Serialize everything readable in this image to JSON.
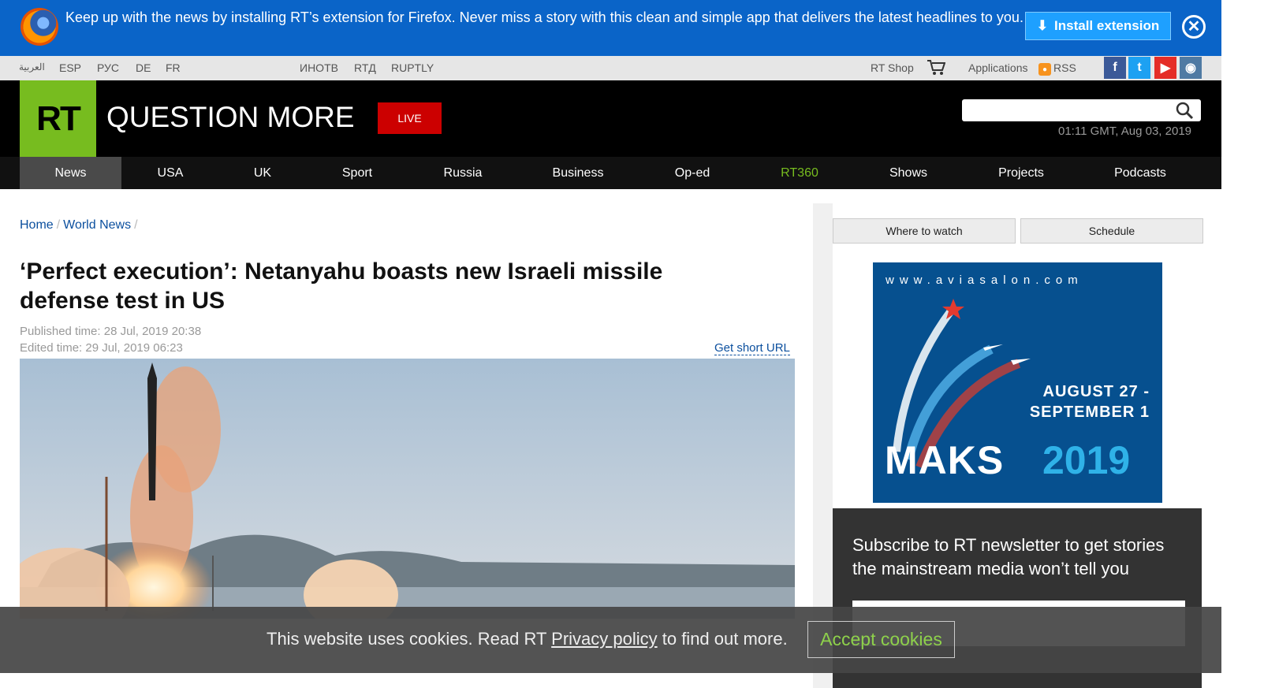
{
  "banner": {
    "text": "Keep up with the news by installing RT’s extension for Firefox. Never miss a story with this clean and simple app that delivers the latest headlines to you.",
    "install_label": "Install extension",
    "icons": [
      "firefox-icon",
      "download-arrow-icon",
      "close-icon"
    ]
  },
  "utility": {
    "languages": [
      "العربية",
      "ESP",
      "РУС",
      "DE",
      "FR"
    ],
    "networks": [
      "ИНОТВ",
      "RTД",
      "RUPTLY"
    ],
    "shop": "RT Shop",
    "applications": "Applications",
    "rss": "RSS",
    "social": [
      "facebook",
      "twitter",
      "youtube",
      "instagram"
    ]
  },
  "header": {
    "logo": "RT",
    "tagline": "QUESTION MORE",
    "live": "LIVE",
    "search_placeholder": "",
    "datetime": "01:11 GMT, Aug 03, 2019"
  },
  "nav": {
    "items": [
      "News",
      "USA",
      "UK",
      "Sport",
      "Russia",
      "Business",
      "Op-ed",
      "RT360",
      "Shows",
      "Projects",
      "Podcasts"
    ],
    "active": "News"
  },
  "breadcrumb": [
    "Home",
    "World News"
  ],
  "article": {
    "title": "‘Perfect execution’: Netanyahu boasts new Israeli missile defense test in US",
    "published": "Published time: 28 Jul, 2019 20:38",
    "edited": "Edited time: 29 Jul, 2019 06:23",
    "short_url": "Get short URL"
  },
  "sidebar": {
    "where_to_watch": "Where to watch",
    "schedule": "Schedule",
    "ad": {
      "url": "www.aviasalon.com",
      "dates_line1": "AUGUST 27 -",
      "dates_line2": "SEPTEMBER 1",
      "name": "MAKS",
      "year": "2019"
    },
    "newsletter": "Subscribe to RT newsletter to get stories the mainstream media won’t tell you"
  },
  "cookie": {
    "text_before": "This website uses cookies. Read RT ",
    "link": "Privacy policy",
    "text_after": " to find out more.",
    "accept": "Accept cookies"
  },
  "colors": {
    "banner": "#0a64c8",
    "rt_green": "#77bc1f",
    "live_red": "#cc0000",
    "link_blue": "#0b4f9e"
  }
}
